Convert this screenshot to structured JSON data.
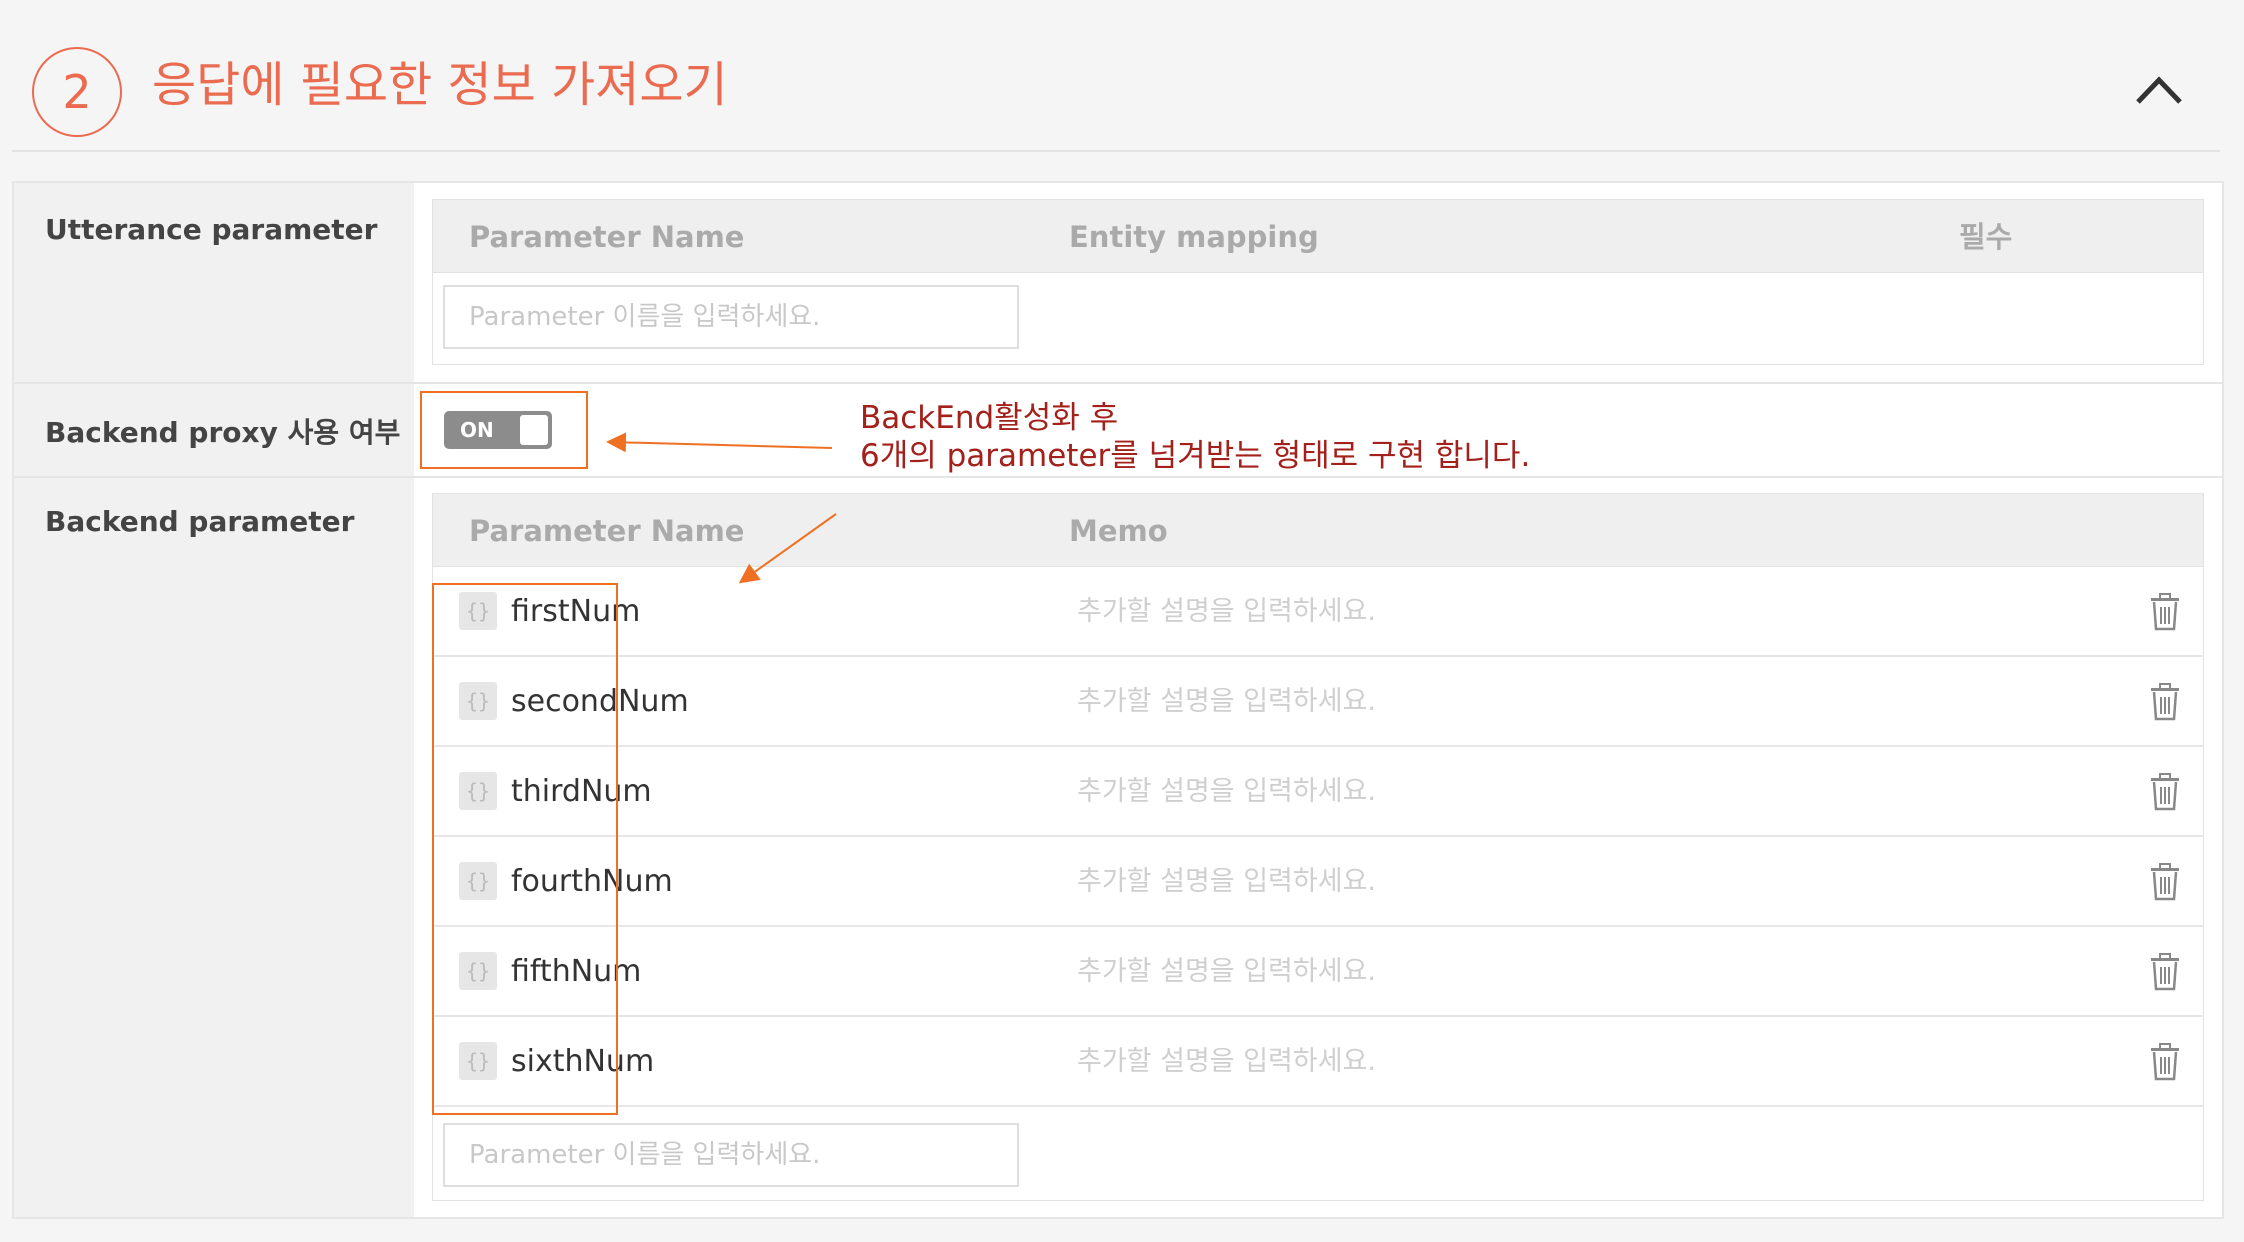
{
  "section": {
    "step_number": "2",
    "title": "응답에 필요한 정보 가져오기"
  },
  "utterance": {
    "label": "Utterance parameter",
    "columns": [
      "Parameter Name",
      "Entity mapping",
      "필수"
    ],
    "input_placeholder": "Parameter 이름을 입력하세요."
  },
  "backend_proxy": {
    "label": "Backend proxy 사용 여부",
    "toggle_text": "ON",
    "enabled": true
  },
  "annotation": {
    "line1": "BackEnd활성화 후",
    "line2": "6개의 parameter를 넘겨받는 형태로 구현 합니다.",
    "color": "#a3201b",
    "box_color": "#f07023"
  },
  "backend_parameter": {
    "label": "Backend parameter",
    "columns": [
      "Parameter Name",
      "Memo"
    ],
    "rows": [
      {
        "icon": "brace-icon",
        "name": "firstNum",
        "memo_placeholder": "추가할 설명을 입력하세요."
      },
      {
        "icon": "brace-icon",
        "name": "secondNum",
        "memo_placeholder": "추가할 설명을 입력하세요."
      },
      {
        "icon": "brace-icon",
        "name": "thirdNum",
        "memo_placeholder": "추가할 설명을 입력하세요."
      },
      {
        "icon": "brace-icon",
        "name": "fourthNum",
        "memo_placeholder": "추가할 설명을 입력하세요."
      },
      {
        "icon": "brace-icon",
        "name": "fifthNum",
        "memo_placeholder": "추가할 설명을 입력하세요."
      },
      {
        "icon": "brace-icon",
        "name": "sixthNum",
        "memo_placeholder": "추가할 설명을 입력하세요."
      }
    ],
    "input_placeholder": "Parameter 이름을 입력하세요."
  },
  "colors": {
    "accent": "#ea6b50",
    "label_bg": "#f1f1f1",
    "header_bg": "#efefef"
  }
}
